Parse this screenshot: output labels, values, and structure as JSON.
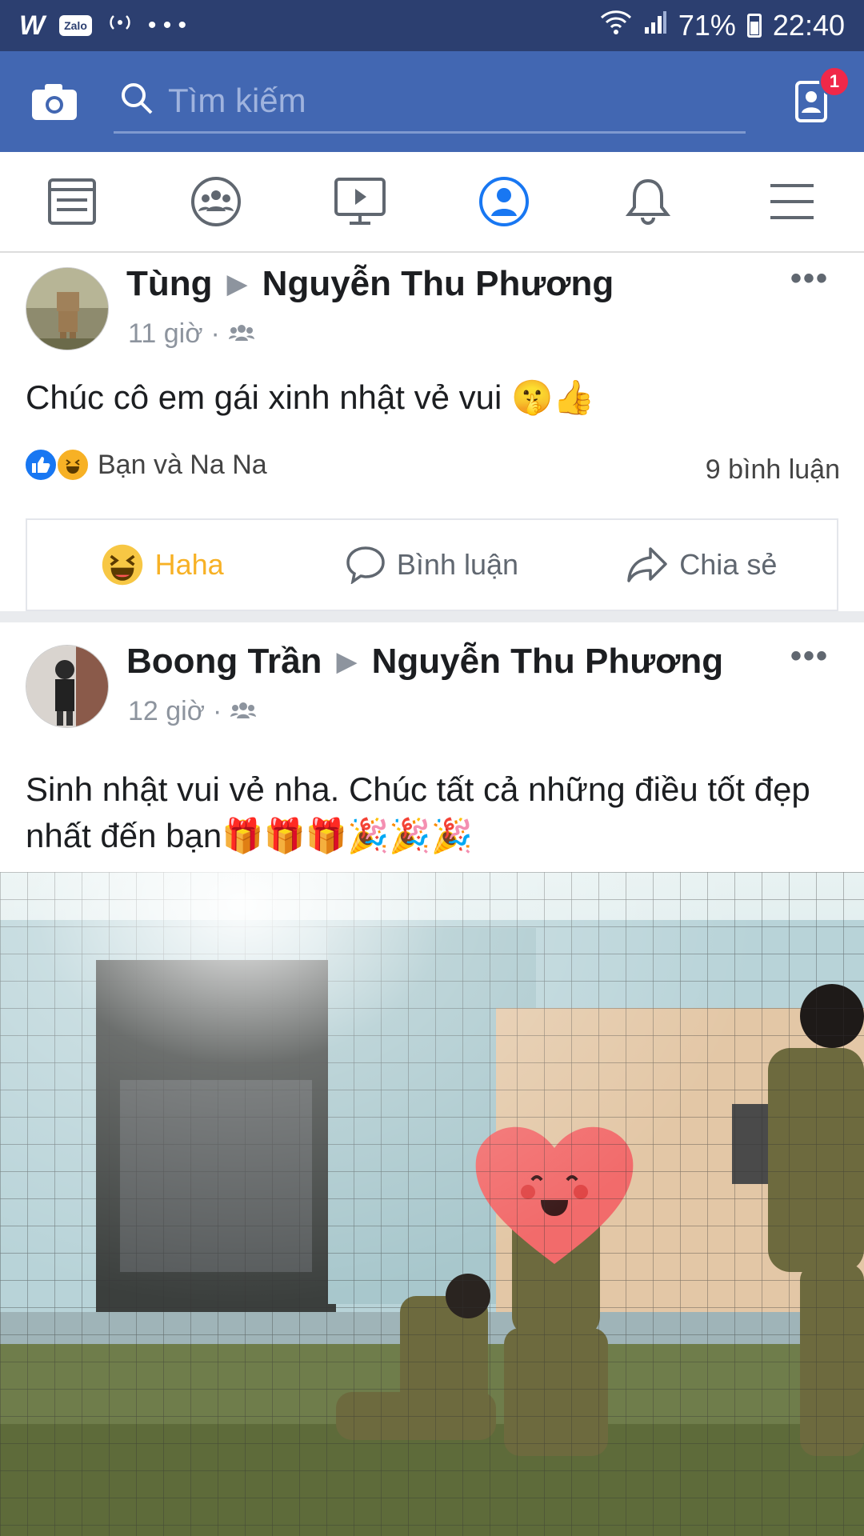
{
  "status_bar": {
    "app_w": "W",
    "app_zalo": "Zalo",
    "dots": "• • •",
    "battery_pct": "71%",
    "time": "22:40"
  },
  "header": {
    "search_placeholder": "Tìm kiếm",
    "badge_count": "1"
  },
  "nav": {
    "active": "profile"
  },
  "posts": [
    {
      "author": "Tùng",
      "target": "Nguyễn Thu Phương",
      "time": "11 giờ",
      "text": "Chúc cô em gái xinh nhật vẻ vui 🤫👍",
      "reactions_label": "Bạn và Na Na",
      "comments_label": "9 bình luận",
      "actions": [
        "Haha",
        "Bình luận",
        "Chia sẻ"
      ]
    },
    {
      "author": "Boong Trần",
      "target": "Nguyễn Thu Phương",
      "time": "12 giờ",
      "text": "Sinh nhật vui vẻ nha. Chúc tất cả những điều tốt đẹp nhất đến bạn🎁🎁🎁🎉🎉🎉"
    }
  ],
  "colors": {
    "status_bg": "#2c3f70",
    "header_bg": "#4267b2",
    "active_icon": "#1877f2",
    "haha": "#f7b125"
  }
}
